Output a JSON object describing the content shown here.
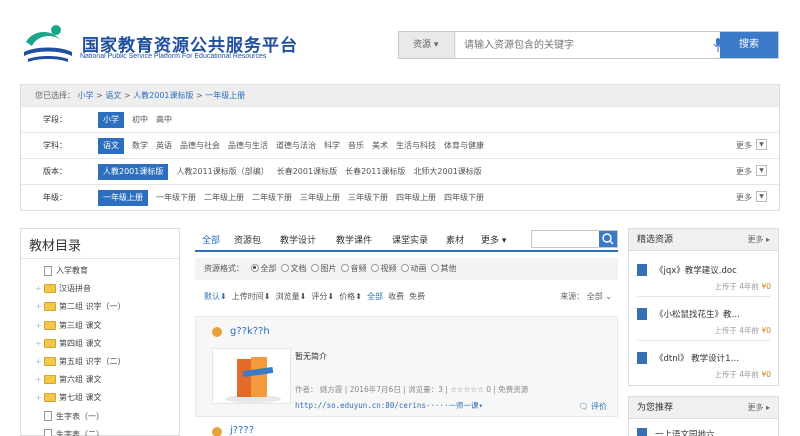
{
  "header": {
    "title": "国家教育资源公共服务平台",
    "subtitle": "National Public Service Platform For Educational Resources",
    "search_type": "资源",
    "search_placeholder": "请输入资源包含的关键字",
    "search_button": "搜索"
  },
  "filter": {
    "crumb_label": "您已选择：",
    "crumbs": [
      "小学",
      "语文",
      "人教2001课标版",
      "一年级上册"
    ],
    "rows": [
      {
        "label": "学段：",
        "options": [
          "小学",
          "初中",
          "高中"
        ],
        "selected": 0,
        "more": ""
      },
      {
        "label": "学科：",
        "options": [
          "语文",
          "数学",
          "英语",
          "品德与社会",
          "品德与生活",
          "道德与法治",
          "科学",
          "音乐",
          "美术",
          "生活与科技",
          "体育与健康"
        ],
        "selected": 0,
        "more": "更多"
      },
      {
        "label": "版本：",
        "options": [
          "人教2001课标版",
          "人教2011课标版（部编）",
          "长春2001课标版",
          "长春2011课标版",
          "北师大2001课标版"
        ],
        "selected": 0,
        "more": "更多"
      },
      {
        "label": "年级：",
        "options": [
          "一年级上册",
          "一年级下册",
          "二年级上册",
          "二年级下册",
          "三年级上册",
          "三年级下册",
          "四年级上册",
          "四年级下册"
        ],
        "selected": 0,
        "more": "更多"
      }
    ]
  },
  "sidebar": {
    "title": "教材目录",
    "items": [
      {
        "label": "入学教育",
        "type": "doc"
      },
      {
        "label": "汉语拼音",
        "type": "folder"
      },
      {
        "label": "第二组 识字（一）",
        "type": "folder"
      },
      {
        "label": "第三组 课文",
        "type": "folder"
      },
      {
        "label": "第四组 课文",
        "type": "folder"
      },
      {
        "label": "第五组 识字（二）",
        "type": "folder"
      },
      {
        "label": "第六组 课文",
        "type": "folder"
      },
      {
        "label": "第七组 课文",
        "type": "folder"
      },
      {
        "label": "生字表（一）",
        "type": "doc"
      },
      {
        "label": "生字表（二）",
        "type": "doc"
      }
    ]
  },
  "main": {
    "tabs": [
      "全部",
      "资源包",
      "教学设计",
      "教学课件",
      "课堂实录",
      "素材",
      "更多"
    ],
    "format_label": "资源格式：",
    "formats": [
      "全部",
      "文档",
      "图片",
      "音频",
      "视频",
      "动画",
      "其他"
    ],
    "sorts": [
      "默认",
      "上传时间",
      "浏览量",
      "评分",
      "价格"
    ],
    "quick_filters": [
      "全部",
      "收费",
      "免费"
    ],
    "source_label": "来源：",
    "source_value": "全部",
    "card": {
      "title": "g??k??h",
      "desc": "暂无简介",
      "author_label": "作者：",
      "author": "姚方霞",
      "date": "2016年7月6日",
      "views": "浏览量：3",
      "rating": "☆☆☆☆☆ 0",
      "price": "免费资源",
      "url": "http://so.eduyun.cn:80/cerins·····一师一课",
      "eval": "评价"
    },
    "card2_title": "j????"
  },
  "featured": {
    "title": "精选资源",
    "more": "更多",
    "items": [
      {
        "title": "《jqx》教学建议.doc",
        "uploaded": "上传于 4年前",
        "price": "¥0"
      },
      {
        "title": "《小松鼠找花生》教…",
        "uploaded": "上传于 4年前",
        "price": "¥0"
      },
      {
        "title": "《dtnl》 教学设计1…",
        "uploaded": "上传于 4年前",
        "price": "¥0"
      }
    ]
  },
  "recommend": {
    "title": "为您推荐",
    "more": "更多",
    "items": [
      {
        "title": "一上语文园地六"
      }
    ]
  },
  "colors": {
    "accent": "#2b6fbe",
    "brand": "#1f4fa0",
    "price": "#e07a18"
  }
}
